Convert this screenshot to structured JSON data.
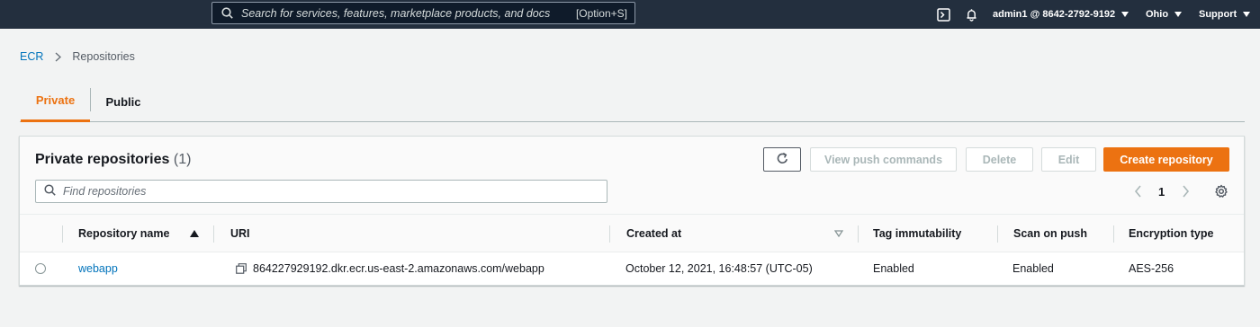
{
  "topnav": {
    "search_placeholder": "Search for services, features, marketplace products, and docs",
    "search_shortcut": "[Option+S]",
    "account": "admin1 @ 8642-2792-9192",
    "region": "Ohio",
    "support": "Support"
  },
  "breadcrumb": {
    "root": "ECR",
    "current": "Repositories"
  },
  "tabs": {
    "private": "Private",
    "public": "Public"
  },
  "panel": {
    "title": "Private repositories",
    "count": "(1)",
    "buttons": {
      "view_push": "View push commands",
      "delete": "Delete",
      "edit": "Edit",
      "create": "Create repository"
    },
    "find_placeholder": "Find repositories",
    "page": "1"
  },
  "table": {
    "headers": {
      "name": "Repository name",
      "uri": "URI",
      "created": "Created at",
      "tag": "Tag immutability",
      "scan": "Scan on push",
      "enc": "Encryption type"
    },
    "rows": [
      {
        "name": "webapp",
        "uri": "864227929192.dkr.ecr.us-east-2.amazonaws.com/webapp",
        "created": "October 12, 2021, 16:48:57 (UTC-05)",
        "tag": "Enabled",
        "scan": "Enabled",
        "enc": "AES-256"
      }
    ]
  },
  "colors": {
    "nav_bg": "#232f3e",
    "accent": "#ec7211",
    "link": "#0073bb"
  }
}
